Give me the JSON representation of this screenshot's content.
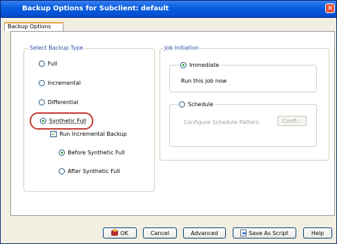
{
  "window": {
    "title": "Backup Options for Subclient: default",
    "close_label": "✕"
  },
  "tabs": [
    {
      "label": "Backup Options"
    }
  ],
  "backup_type": {
    "legend": "Select Backup Type",
    "options": [
      {
        "label": "Full",
        "selected": false
      },
      {
        "label": "Incremental",
        "selected": false
      },
      {
        "label": "Differential",
        "selected": false
      },
      {
        "label": "Synthetic Full",
        "selected": true
      }
    ],
    "run_incremental": {
      "label": "Run Incremental Backup",
      "checked": true,
      "mark": "✓"
    },
    "timing": [
      {
        "label": "Before Synthetic Full",
        "selected": true
      },
      {
        "label": "After Synthetic Full",
        "selected": false
      }
    ]
  },
  "job_initiation": {
    "legend": "Job Initiation",
    "immediate": {
      "label": "Immediate",
      "selected": true,
      "description": "Run this job now"
    },
    "schedule": {
      "label": "Schedule",
      "selected": false,
      "pattern_label": "Configure Schedule Pattern",
      "config_button": "Confi..."
    }
  },
  "buttons": {
    "ok": "OK",
    "cancel": "Cancel",
    "advanced": "Advanced",
    "save_script": "Save As Script",
    "help": "Help"
  },
  "colors": {
    "titlebar": "#0550d4",
    "highlight": "#c0392b",
    "legend": "#2f4fa2"
  }
}
